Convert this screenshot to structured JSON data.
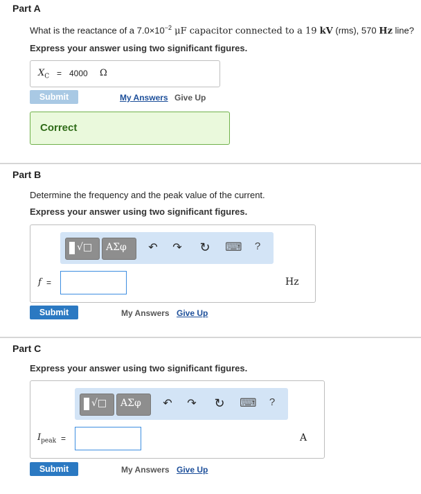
{
  "partA": {
    "title": "Part A",
    "question": {
      "pre": "What is the reactance of a 7.0×10",
      "exp": "−2",
      "mid": " μF capacitor connected to a 19 ",
      "kv": "kV",
      "rms": " (rms), 570 ",
      "hz": "Hz",
      "post": " line?"
    },
    "instruction": "Express your answer using two significant figures.",
    "answer": {
      "var": "X",
      "sub": "C",
      "eq": "=",
      "value": "4000",
      "unit": "Ω"
    },
    "submit": "Submit",
    "my_answers": "My Answers",
    "give_up": "Give Up",
    "feedback": "Correct"
  },
  "partB": {
    "title": "Part B",
    "question": "Determine the frequency and the peak value of the current.",
    "instruction": "Express your answer using two significant figures.",
    "toolbar": {
      "templates": "√□",
      "symbols": "ΑΣφ",
      "undo": "↶",
      "redo": "↷",
      "reset": "↻",
      "keyboard": "⌨",
      "help": "?"
    },
    "var": "f",
    "eq": "=",
    "value": "",
    "unit": "Hz",
    "submit": "Submit",
    "my_answers": "My Answers",
    "give_up": "Give Up"
  },
  "partC": {
    "title": "Part C",
    "instruction": "Express your answer using two significant figures.",
    "toolbar": {
      "templates": "√□",
      "symbols": "ΑΣφ",
      "undo": "↶",
      "redo": "↷",
      "reset": "↻",
      "keyboard": "⌨",
      "help": "?"
    },
    "var": "I",
    "sub": "peak",
    "eq": "=",
    "value": "",
    "unit": "A",
    "submit": "Submit",
    "my_answers": "My Answers",
    "give_up": "Give Up"
  },
  "colors": {
    "primary": "#2b79c2",
    "disabled": "#a9c9e4",
    "correct_bg": "#eaf9dc",
    "correct_border": "#6fb04a",
    "toolbar_bg": "#d3e4f6"
  }
}
